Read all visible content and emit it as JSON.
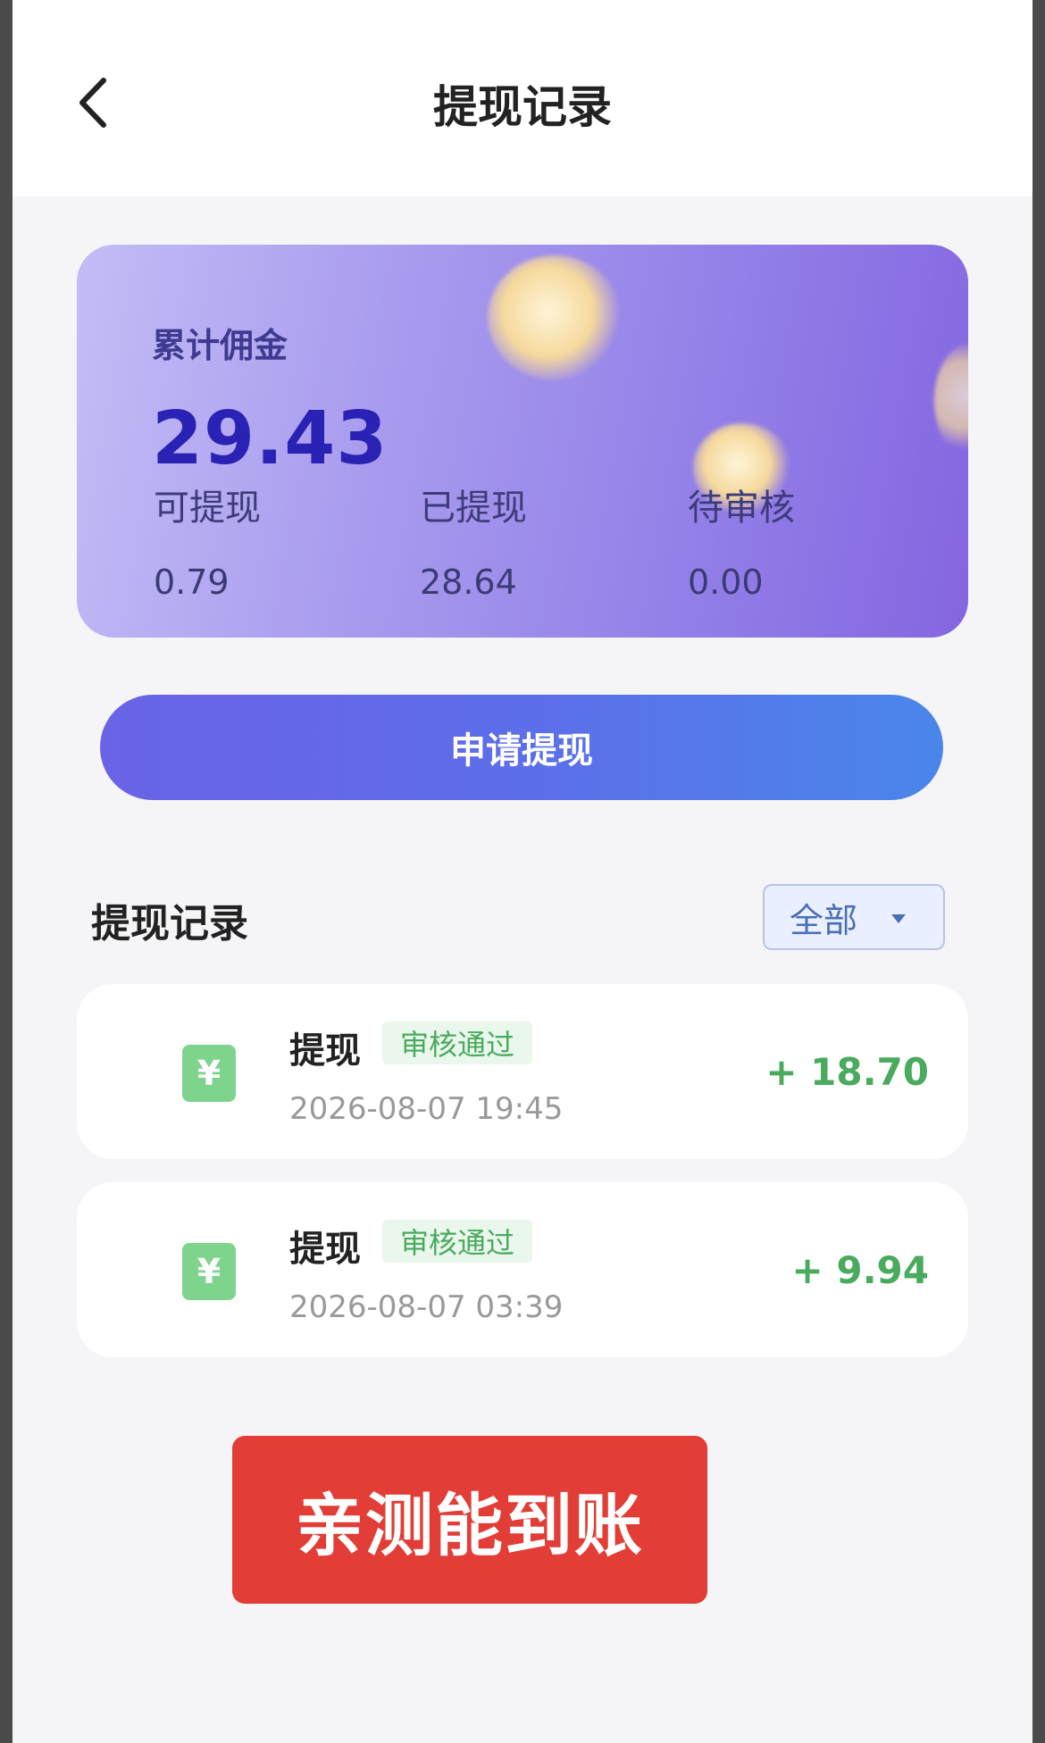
{
  "header": {
    "title": "提现记录",
    "back_icon": "chevron-left-icon"
  },
  "summary": {
    "total_label": "累计佣金",
    "total_value": "29.43",
    "stats": [
      {
        "label": "可提现",
        "value": "0.79"
      },
      {
        "label": "已提现",
        "value": "28.64"
      },
      {
        "label": "待审核",
        "value": "0.00"
      }
    ],
    "accent_color": "#2a22b5"
  },
  "apply_button": {
    "label": "申请提现"
  },
  "records": {
    "title": "提现记录",
    "filter": {
      "selected": "全部",
      "icon": "caret-down-icon"
    },
    "items": [
      {
        "icon": "yuan-icon",
        "icon_text": "¥",
        "title": "提现",
        "status": "审核通过",
        "time": "2026-08-07 19:45",
        "amount": "+ 18.70"
      },
      {
        "icon": "yuan-icon",
        "icon_text": "¥",
        "title": "提现",
        "status": "审核通过",
        "time": "2026-08-07 03:39",
        "amount": "+ 9.94"
      }
    ],
    "status_color": "#4aaa5e"
  },
  "stamp": {
    "text": "亲测能到账",
    "color": "#e23d36"
  }
}
